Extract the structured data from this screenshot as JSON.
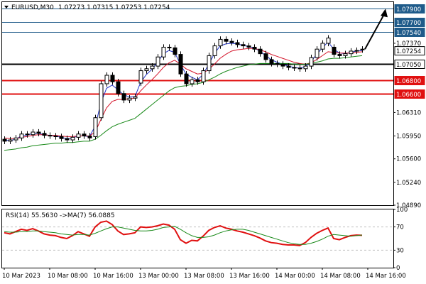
{
  "header": {
    "symbol": "EURUSD,M30",
    "ohlc": "1.07273 1.07315 1.07253 1.07254"
  },
  "rsi_header": "RSI(14) 55.5630  ->MA(7) 56.0885",
  "colors": {
    "candle": "#000000",
    "ema_fast": "#2033c8",
    "ema_mid": "#d4142a",
    "ema_slow": "#1a8a1a",
    "level_blue": "#1f5b8a",
    "level_red": "#e01010",
    "level_black": "#000000",
    "rsi_line": "#e01010",
    "rsi_ma": "#1a8a1a",
    "grid": "#c0c0c0"
  },
  "chart_data": [
    {
      "type": "candlestick",
      "name": "price",
      "ylim": [
        1.0489,
        1.08
      ],
      "y_ticks": [
        "1.07900",
        "1.07700",
        "1.07540",
        "1.07370",
        "1.07254",
        "1.07050",
        "1.06800",
        "1.06600",
        "1.06310",
        "1.05950",
        "1.05600",
        "1.05240",
        "1.04890"
      ],
      "x_ticks": [
        "10 Mar 2023",
        "10 Mar 08:00",
        "10 Mar 16:00",
        "13 Mar 00:00",
        "13 Mar 08:00",
        "13 Mar 16:00",
        "14 Mar 00:00",
        "14 Mar 08:00",
        "14 Mar 16:00"
      ],
      "tick_index": [
        0,
        8,
        16,
        24,
        32,
        40,
        48,
        56,
        64
      ],
      "closes": [
        1.0587,
        1.0589,
        1.0592,
        1.0598,
        1.0597,
        1.0601,
        1.0599,
        1.0596,
        1.0595,
        1.0594,
        1.0591,
        1.0589,
        1.0593,
        1.0598,
        1.0595,
        1.0592,
        1.0623,
        1.0675,
        1.0688,
        1.0678,
        1.066,
        1.065,
        1.0653,
        1.0655,
        1.0695,
        1.0698,
        1.0702,
        1.0716,
        1.0731,
        1.073,
        1.072,
        1.069,
        1.0675,
        1.0681,
        1.0678,
        1.0695,
        1.0718,
        1.0733,
        1.0743,
        1.074,
        1.0738,
        1.0735,
        1.0733,
        1.0731,
        1.0728,
        1.0721,
        1.0712,
        1.0706,
        1.0705,
        1.0702,
        1.07,
        1.0699,
        1.0698,
        1.0702,
        1.0715,
        1.0728,
        1.0737,
        1.0745,
        1.072,
        1.0718,
        1.0721,
        1.0725,
        1.0726,
        1.0728
      ],
      "opens": [
        1.059,
        1.0587,
        1.0589,
        1.0592,
        1.0598,
        1.0597,
        1.0601,
        1.0599,
        1.0596,
        1.0595,
        1.0594,
        1.0591,
        1.0589,
        1.0593,
        1.0598,
        1.0595,
        1.0594,
        1.0623,
        1.0675,
        1.0688,
        1.0678,
        1.066,
        1.065,
        1.0653,
        1.0676,
        1.0695,
        1.0698,
        1.0702,
        1.0716,
        1.0731,
        1.073,
        1.072,
        1.069,
        1.0675,
        1.0681,
        1.0678,
        1.0695,
        1.0718,
        1.0733,
        1.0743,
        1.074,
        1.0738,
        1.0735,
        1.0733,
        1.0731,
        1.0728,
        1.0721,
        1.0712,
        1.0706,
        1.0705,
        1.0702,
        1.07,
        1.0699,
        1.0698,
        1.0702,
        1.0715,
        1.0728,
        1.0737,
        1.0731,
        1.072,
        1.0718,
        1.0721,
        1.0725,
        1.0727
      ],
      "series": [
        {
          "name": "ema_fast",
          "values": [
            1.0589,
            1.0588,
            1.059,
            1.0595,
            1.0596,
            1.0599,
            1.0599,
            1.0597,
            1.0596,
            1.0595,
            1.0593,
            1.0591,
            1.0592,
            1.0595,
            1.0595,
            1.0594,
            1.061,
            1.0645,
            1.0668,
            1.0673,
            1.0666,
            1.0658,
            1.0655,
            1.0655,
            1.0677,
            1.0689,
            1.0697,
            1.0708,
            1.0721,
            1.0726,
            1.0723,
            1.0705,
            1.069,
            1.0685,
            1.0681,
            1.0689,
            1.0705,
            1.0721,
            1.0733,
            1.0736,
            1.0737,
            1.0736,
            1.0734,
            1.0732,
            1.073,
            1.0725,
            1.0718,
            1.0712,
            1.0708,
            1.0705,
            1.0702,
            1.07,
            1.0699,
            1.0701,
            1.0709,
            1.072,
            1.073,
            1.0739,
            1.0728,
            1.0722,
            1.0721,
            1.0723,
            1.0725,
            1.0726
          ]
        },
        {
          "name": "ema_mid",
          "values": [
            1.0592,
            1.0591,
            1.0591,
            1.0593,
            1.0594,
            1.0596,
            1.0597,
            1.0597,
            1.0596,
            1.0596,
            1.0595,
            1.0594,
            1.0594,
            1.0595,
            1.0595,
            1.0595,
            1.0601,
            1.062,
            1.0638,
            1.0648,
            1.0651,
            1.0651,
            1.0652,
            1.0653,
            1.0664,
            1.0673,
            1.0681,
            1.069,
            1.07,
            1.0707,
            1.0711,
            1.0705,
            1.0698,
            1.0694,
            1.069,
            1.0691,
            1.0697,
            1.0705,
            1.0714,
            1.072,
            1.0725,
            1.0727,
            1.0728,
            1.0729,
            1.0729,
            1.0727,
            1.0724,
            1.072,
            1.0717,
            1.0714,
            1.0711,
            1.0708,
            1.0706,
            1.0705,
            1.0707,
            1.0712,
            1.0718,
            1.0724,
            1.0723,
            1.0722,
            1.0722,
            1.0722,
            1.0723,
            1.0724
          ]
        },
        {
          "name": "ema_slow",
          "values": [
            1.0573,
            1.0574,
            1.0575,
            1.0577,
            1.0578,
            1.058,
            1.0581,
            1.0582,
            1.0583,
            1.0584,
            1.0584,
            1.0585,
            1.0585,
            1.0586,
            1.0587,
            1.0587,
            1.059,
            1.0596,
            1.0603,
            1.0609,
            1.0613,
            1.0616,
            1.0619,
            1.0622,
            1.0629,
            1.0636,
            1.0643,
            1.065,
            1.0657,
            1.0664,
            1.0669,
            1.0671,
            1.0672,
            1.0674,
            1.0675,
            1.0677,
            1.0681,
            1.0685,
            1.069,
            1.0694,
            1.0697,
            1.07,
            1.0702,
            1.0704,
            1.0705,
            1.0706,
            1.0706,
            1.0706,
            1.0706,
            1.0706,
            1.0706,
            1.0705,
            1.0705,
            1.0705,
            1.0706,
            1.0708,
            1.071,
            1.0713,
            1.0714,
            1.0714,
            1.0715,
            1.0716,
            1.0717,
            1.0718
          ]
        }
      ],
      "levels": [
        {
          "label": "1.07900",
          "value": 1.079,
          "kind": "blue"
        },
        {
          "label": "1.07700",
          "value": 1.077,
          "kind": "blue"
        },
        {
          "label": "1.07540",
          "value": 1.0754,
          "kind": "blue"
        },
        {
          "label": "1.07050",
          "value": 1.0705,
          "kind": "black"
        },
        {
          "label": "1.06800",
          "value": 1.068,
          "kind": "red"
        },
        {
          "label": "1.06600",
          "value": 1.066,
          "kind": "red"
        }
      ],
      "current_price": "1.07254",
      "projection": {
        "from": 1.0728,
        "to": 1.079
      }
    },
    {
      "type": "line",
      "name": "rsi",
      "ylim": [
        0,
        100
      ],
      "y_ticks": [
        "100",
        "70",
        "30",
        "0"
      ],
      "series": [
        {
          "name": "RSI(14)",
          "values": [
            60,
            58,
            62,
            66,
            64,
            67,
            63,
            58,
            56,
            55,
            52,
            50,
            55,
            62,
            58,
            54,
            70,
            78,
            80,
            74,
            63,
            57,
            58,
            60,
            70,
            69,
            70,
            72,
            75,
            73,
            66,
            48,
            42,
            47,
            46,
            54,
            64,
            69,
            72,
            68,
            66,
            63,
            61,
            58,
            55,
            51,
            46,
            43,
            42,
            40,
            39,
            39,
            38,
            43,
            52,
            59,
            64,
            68,
            50,
            48,
            52,
            55,
            56,
            55.56
          ]
        },
        {
          "name": "MA(7)",
          "values": [
            62,
            61,
            61,
            62,
            62,
            63,
            63,
            62,
            61,
            60,
            58,
            57,
            56,
            57,
            57,
            56,
            59,
            63,
            67,
            70,
            70,
            68,
            66,
            64,
            63,
            63,
            64,
            66,
            69,
            70,
            71,
            66,
            60,
            55,
            52,
            52,
            53,
            56,
            60,
            63,
            65,
            66,
            66,
            64,
            61,
            58,
            55,
            52,
            49,
            46,
            43,
            41,
            40,
            40,
            42,
            45,
            49,
            54,
            57,
            56,
            55,
            54,
            55,
            56.09
          ]
        }
      ],
      "levels": [
        70,
        30
      ]
    }
  ]
}
